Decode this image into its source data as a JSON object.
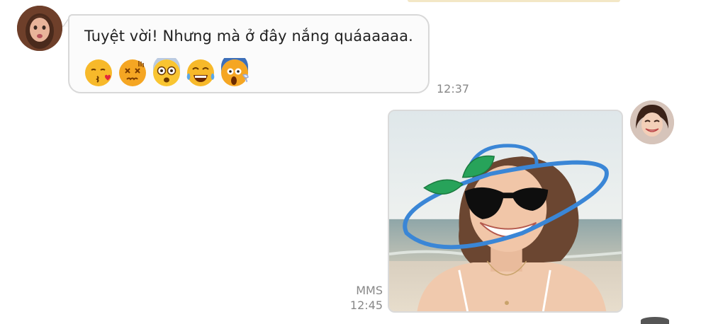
{
  "conversation": {
    "incoming": {
      "text": "Tuyệt vời! Nhưng mà ở đây nắng quáaaaaa.",
      "emojis": [
        "kissing-heart-emoji",
        "dizzy-face-emoji",
        "astonished-emoji",
        "joy-tears-emoji",
        "screaming-emoji"
      ],
      "time": "12:37"
    },
    "outgoing": {
      "type": "MMS",
      "attachment": "drawn-on-beach-photo",
      "time": "12:45"
    }
  },
  "colors": {
    "bubble_border": "#d8d8d8",
    "timestamp": "#888888",
    "hat_drawing": "#3a86d6",
    "leaf": "#27a35a"
  }
}
